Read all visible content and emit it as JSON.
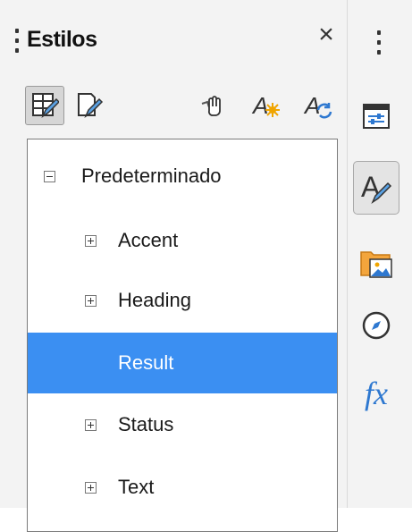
{
  "deck": {
    "title": "Estilos",
    "close_glyph": "×",
    "accent_color": "#3b8ff2",
    "toolbar": [
      {
        "name": "paragraph-styles-icon",
        "active": true
      },
      {
        "name": "character-styles-icon",
        "active": false
      },
      {
        "name": "fill-format-mode-icon",
        "active": false
      },
      {
        "name": "new-style-from-selection-icon",
        "active": false
      },
      {
        "name": "update-style-icon",
        "active": false
      }
    ]
  },
  "styles_tree": {
    "root": {
      "label": "Predeterminado",
      "expander": "minus"
    },
    "children": [
      {
        "label": "Accent",
        "expander": "plus",
        "selected": false
      },
      {
        "label": "Heading",
        "expander": "plus",
        "selected": false
      },
      {
        "label": "Result",
        "expander": "none",
        "selected": true
      },
      {
        "label": "Status",
        "expander": "plus",
        "selected": false
      },
      {
        "label": "Text",
        "expander": "plus",
        "selected": false
      }
    ]
  },
  "sidebar_tabs": [
    {
      "name": "properties-icon",
      "active": false
    },
    {
      "name": "styles-icon",
      "active": true
    },
    {
      "name": "gallery-icon",
      "active": false
    },
    {
      "name": "navigator-icon",
      "active": false
    },
    {
      "name": "functions-icon",
      "active": false,
      "glyph": "fx"
    }
  ]
}
